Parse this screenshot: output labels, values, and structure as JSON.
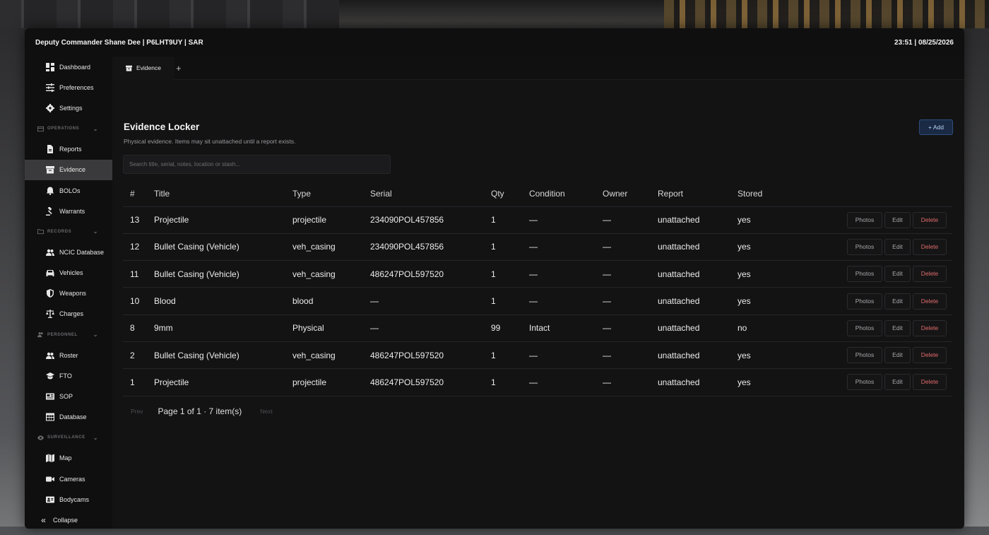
{
  "header": {
    "user": "Deputy Commander Shane Dee | P6LHT9UY | SAR",
    "clock": "23:51 | 08/25/2026"
  },
  "sidebar": {
    "items_top": [
      {
        "label": "Dashboard",
        "icon": "dashboard-icon"
      },
      {
        "label": "Preferences",
        "icon": "sliders-icon"
      },
      {
        "label": "Settings",
        "icon": "gear-icon"
      }
    ],
    "operations": {
      "label": "OPERATIONS",
      "items": [
        {
          "label": "Reports",
          "icon": "file-icon"
        },
        {
          "label": "Evidence",
          "icon": "box-icon"
        },
        {
          "label": "BOLOs",
          "icon": "bell-icon"
        },
        {
          "label": "Warrants",
          "icon": "gavel-icon"
        }
      ]
    },
    "records": {
      "label": "RECORDS",
      "items": [
        {
          "label": "NCIC Database",
          "icon": "users-icon"
        },
        {
          "label": "Vehicles",
          "icon": "car-icon"
        },
        {
          "label": "Weapons",
          "icon": "shield-icon"
        },
        {
          "label": "Charges",
          "icon": "scale-icon"
        }
      ]
    },
    "personnel": {
      "label": "PERSONNEL",
      "items": [
        {
          "label": "Roster",
          "icon": "users-icon"
        },
        {
          "label": "FTO",
          "icon": "graduation-cap-icon"
        },
        {
          "label": "SOP",
          "icon": "newspaper-icon"
        },
        {
          "label": "Database",
          "icon": "table-icon"
        }
      ]
    },
    "surveillance": {
      "label": "SURVEILLANCE",
      "items": [
        {
          "label": "Map",
          "icon": "map-icon"
        },
        {
          "label": "Cameras",
          "icon": "video-icon"
        },
        {
          "label": "Bodycams",
          "icon": "id-card-icon"
        }
      ]
    },
    "collapse_label": "Collapse"
  },
  "tabs": {
    "active_label": "Evidence",
    "add_label": "+"
  },
  "page": {
    "title": "Evidence Locker",
    "subtitle": "Physical evidence. Items may sit unattached until a report exists.",
    "add_button": "+ Add",
    "search_placeholder": "Search title, serial, notes, location or stash..."
  },
  "table": {
    "headers": {
      "num": "#",
      "title": "Title",
      "type": "Type",
      "serial": "Serial",
      "qty": "Qty",
      "condition": "Condition",
      "owner": "Owner",
      "report": "Report",
      "stored": "Stored"
    },
    "action_labels": {
      "photos": "Photos",
      "edit": "Edit",
      "delete": "Delete"
    },
    "rows": [
      {
        "num": "13",
        "title": "Projectile",
        "type": "projectile",
        "serial": "234090POL457856",
        "qty": "1",
        "condition": "—",
        "owner": "—",
        "report": "unattached",
        "stored": "yes"
      },
      {
        "num": "12",
        "title": "Bullet Casing (Vehicle)",
        "type": "veh_casing",
        "serial": "234090POL457856",
        "qty": "1",
        "condition": "—",
        "owner": "—",
        "report": "unattached",
        "stored": "yes"
      },
      {
        "num": "11",
        "title": "Bullet Casing (Vehicle)",
        "type": "veh_casing",
        "serial": "486247POL597520",
        "qty": "1",
        "condition": "—",
        "owner": "—",
        "report": "unattached",
        "stored": "yes"
      },
      {
        "num": "10",
        "title": "Blood",
        "type": "blood",
        "serial": "—",
        "qty": "1",
        "condition": "—",
        "owner": "—",
        "report": "unattached",
        "stored": "yes"
      },
      {
        "num": "8",
        "title": "9mm",
        "type": "Physical",
        "serial": "—",
        "qty": "99",
        "condition": "Intact",
        "owner": "—",
        "report": "unattached",
        "stored": "no"
      },
      {
        "num": "2",
        "title": "Bullet Casing (Vehicle)",
        "type": "veh_casing",
        "serial": "486247POL597520",
        "qty": "1",
        "condition": "—",
        "owner": "—",
        "report": "unattached",
        "stored": "yes"
      },
      {
        "num": "1",
        "title": "Projectile",
        "type": "projectile",
        "serial": "486247POL597520",
        "qty": "1",
        "condition": "—",
        "owner": "—",
        "report": "unattached",
        "stored": "yes"
      }
    ]
  },
  "pagination": {
    "prev": "Prev",
    "info": "Page 1 of 1 · 7 item(s)",
    "next": "Next"
  },
  "colors": {
    "window_bg": "#0f0f10",
    "main_bg": "#131314",
    "active_nav": "#3a3a3c",
    "add_button_bg": "#1a2a44",
    "add_button_text": "#b9d2f5",
    "delete_text": "#e06a6a"
  }
}
